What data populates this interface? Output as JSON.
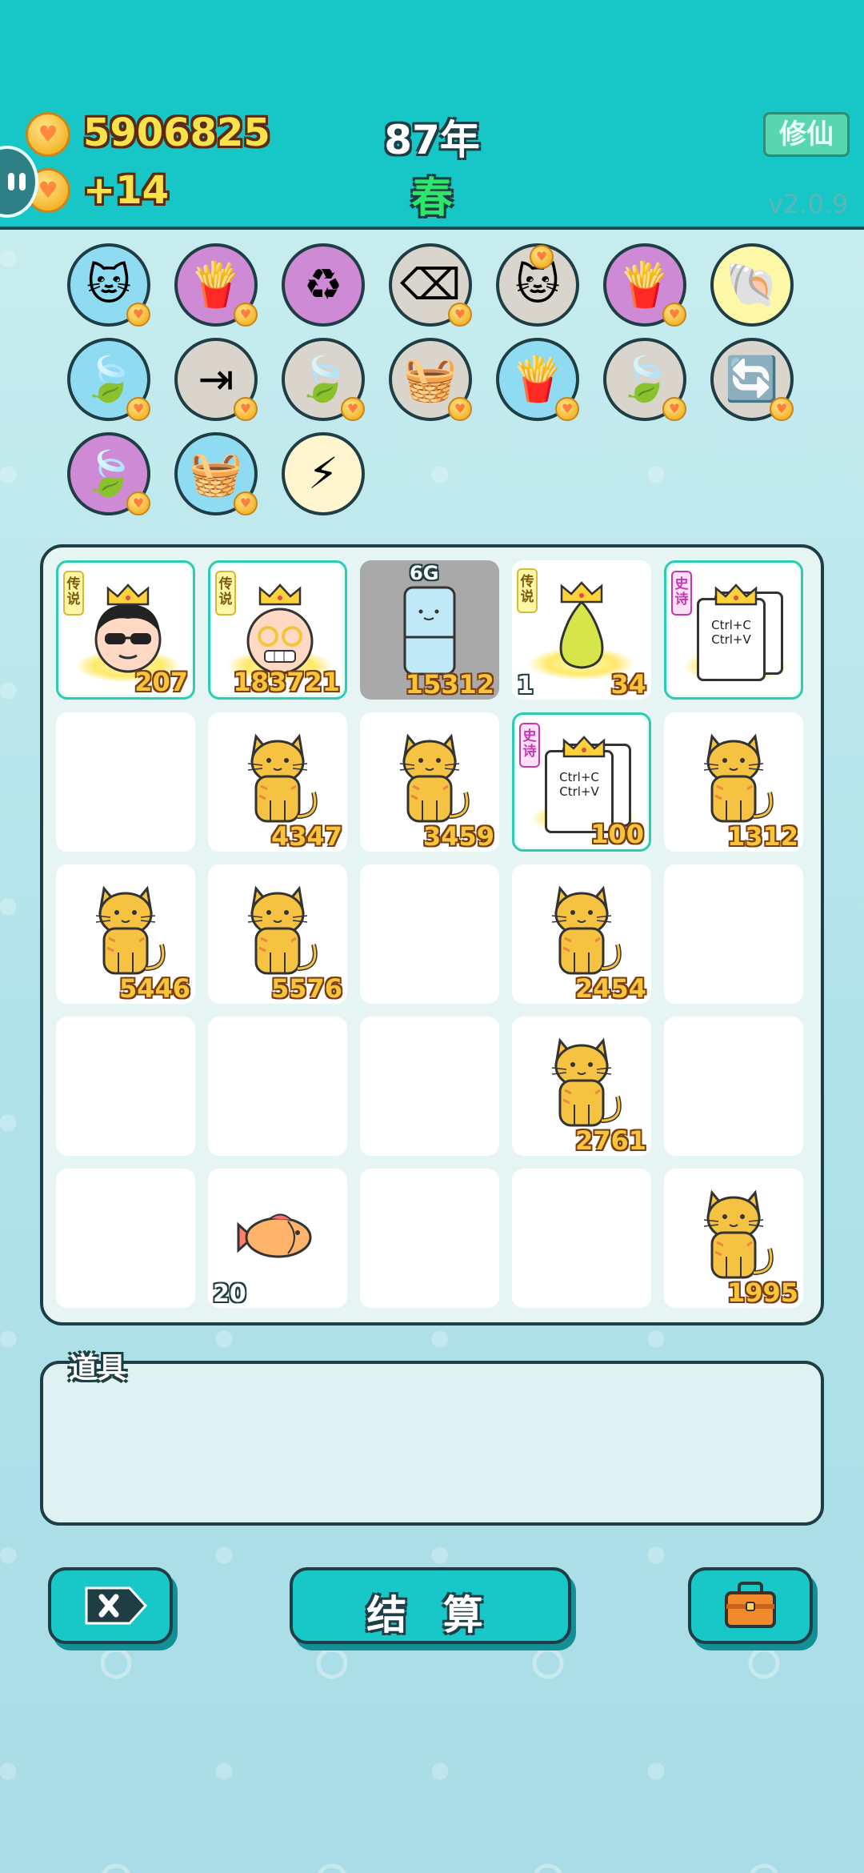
{
  "header": {
    "coins": "5906825",
    "income": "+14",
    "year": "87年",
    "season": "春",
    "mode_button": "修仙",
    "version": "v2.0.9"
  },
  "skills": [
    {
      "name": "cat-portrait-icon",
      "bg": "blue",
      "glyph": "🐱",
      "coin": "bottom"
    },
    {
      "name": "fries-icon",
      "bg": "purple",
      "glyph": "🍟",
      "coin": "bottom"
    },
    {
      "name": "recycle-icon",
      "bg": "purple",
      "glyph": "♻",
      "coin": "none"
    },
    {
      "name": "delete-key-icon",
      "bg": "gray",
      "glyph": "⌫",
      "coin": "bottom"
    },
    {
      "name": "cat-swap-icon",
      "bg": "gray",
      "glyph": "🐱",
      "coin": "top"
    },
    {
      "name": "fries-icon",
      "bg": "purple",
      "glyph": "🍟",
      "coin": "bottom"
    },
    {
      "name": "shell-icon",
      "bg": "yellow",
      "glyph": "🐚",
      "coin": "none"
    },
    {
      "name": "leaf-icon",
      "bg": "blue",
      "glyph": "🍃",
      "coin": "bottom"
    },
    {
      "name": "skip-icon",
      "bg": "gray",
      "glyph": "⇥",
      "coin": "bottom"
    },
    {
      "name": "leaf-icon",
      "bg": "gray",
      "glyph": "🍃",
      "coin": "bottom"
    },
    {
      "name": "fruit-basket-icon",
      "bg": "gray",
      "glyph": "🧺",
      "coin": "bottom"
    },
    {
      "name": "fries-icon",
      "bg": "blue",
      "glyph": "🍟",
      "coin": "bottom"
    },
    {
      "name": "leaf-icon",
      "bg": "gray",
      "glyph": "🍃",
      "coin": "bottom"
    },
    {
      "name": "refresh-icon",
      "bg": "gray",
      "glyph": "🔄",
      "coin": "bottom"
    },
    {
      "name": "leaf-icon",
      "bg": "purple",
      "glyph": "🍃",
      "coin": "bottom"
    },
    {
      "name": "fruit-basket-icon",
      "bg": "blue",
      "glyph": "🧺",
      "coin": "bottom"
    },
    {
      "name": "lightning-icon",
      "bg": "cream",
      "glyph": "⚡",
      "coin": "none"
    }
  ],
  "board": {
    "cells": [
      {
        "item": "cool-man",
        "tag": "传说",
        "tag_type": "legend",
        "count": "207",
        "framed": true,
        "crown": true
      },
      {
        "item": "old-man",
        "tag": "传说",
        "tag_type": "legend",
        "count": "183721",
        "framed": true,
        "crown": true
      },
      {
        "item": "fridge",
        "label": "6G",
        "count": "15312",
        "gray": true
      },
      {
        "item": "pear",
        "tag": "传说",
        "tag_type": "legend",
        "count": "34",
        "left_count": "1",
        "crown": true
      },
      {
        "item": "ctrl-doc",
        "tag": "史诗",
        "tag_type": "epic",
        "framed": true,
        "crown": true,
        "doc_text": [
          "Ctrl+C",
          "Ctrl+V"
        ]
      },
      {
        "item": "empty"
      },
      {
        "item": "cat",
        "count": "4347"
      },
      {
        "item": "cat",
        "count": "3459"
      },
      {
        "item": "ctrl-doc",
        "tag": "史诗",
        "tag_type": "epic",
        "count": "100",
        "framed": true,
        "crown": true,
        "doc_text": [
          "Ctrl+C",
          "Ctrl+V"
        ]
      },
      {
        "item": "cat",
        "count": "1312"
      },
      {
        "item": "cat",
        "count": "5446"
      },
      {
        "item": "cat",
        "count": "5576"
      },
      {
        "item": "empty"
      },
      {
        "item": "cat",
        "count": "2454"
      },
      {
        "item": "empty"
      },
      {
        "item": "empty"
      },
      {
        "item": "empty"
      },
      {
        "item": "empty"
      },
      {
        "item": "cat",
        "count": "2761"
      },
      {
        "item": "empty"
      },
      {
        "item": "empty"
      },
      {
        "item": "fish",
        "left_count": "20"
      },
      {
        "item": "empty"
      },
      {
        "item": "empty"
      },
      {
        "item": "cat",
        "count": "1995"
      }
    ]
  },
  "items_panel": {
    "label": "道具"
  },
  "buttons": {
    "settle": "结 算"
  }
}
